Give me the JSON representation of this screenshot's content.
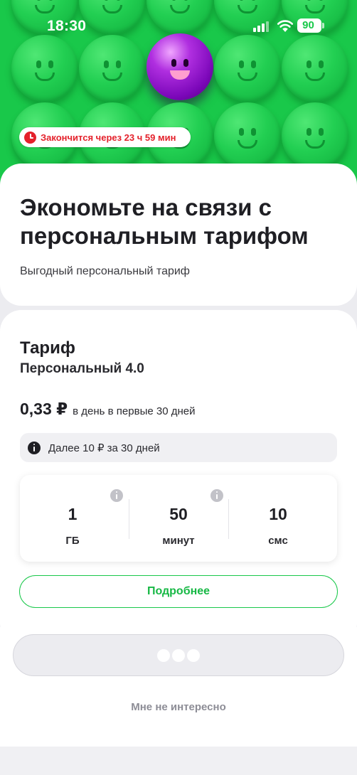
{
  "status_bar": {
    "time": "18:30",
    "battery_percent": "90",
    "signal_icon": "signal-bars-icon",
    "wifi_icon": "wifi-icon"
  },
  "hero": {
    "timer_text": "Закончится через 23 ч 59 мин",
    "timer_icon": "clock-icon",
    "colors": {
      "background": "#19c84a",
      "accent_face": "#7b07b9",
      "timer": "#e4212b"
    }
  },
  "offer": {
    "title": "Экономьте на связи с персональным тарифом",
    "subtitle": "Выгодный персональный тариф"
  },
  "tariff": {
    "heading": "Тариф",
    "name": "Персональный 4.0",
    "price": "0,33 ₽",
    "price_note": "в день в первые 30 дней",
    "info_text": "Далее 10 ₽ за 30 дней",
    "info_icon": "info-icon",
    "stats": [
      {
        "value": "1",
        "unit": "ГБ"
      },
      {
        "value": "50",
        "unit": "минут"
      },
      {
        "value": "10",
        "unit": "смс"
      }
    ],
    "details_label": "Подробнее"
  },
  "actions": {
    "not_interested_label": "Мне не интересно"
  }
}
